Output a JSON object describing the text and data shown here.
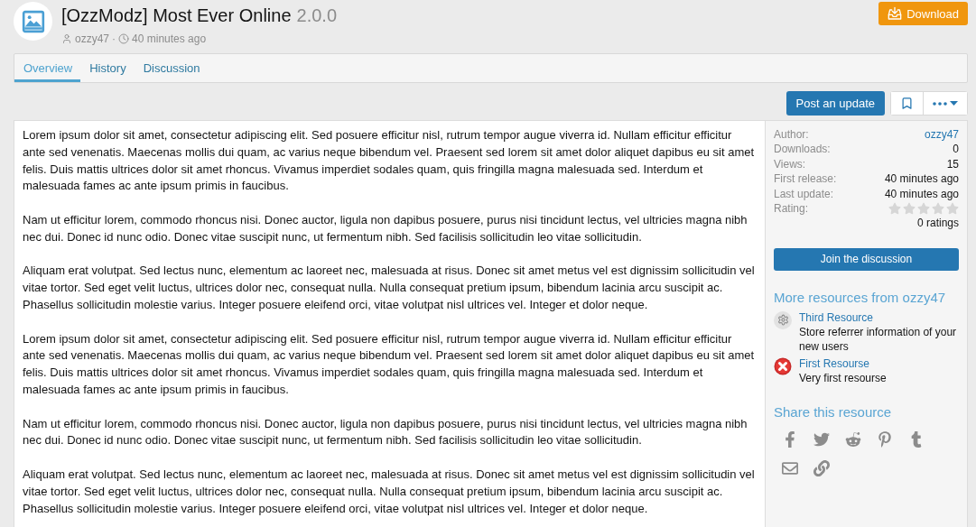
{
  "header": {
    "title": "[OzzModz] Most Ever Online",
    "version": "2.0.0",
    "author": "ozzy47",
    "separator": "·",
    "time": "40 minutes ago",
    "download_button": "Download"
  },
  "tabs": [
    {
      "label": "Overview",
      "selected": true
    },
    {
      "label": "History",
      "selected": false
    },
    {
      "label": "Discussion",
      "selected": false
    }
  ],
  "actions": {
    "post_button": "Post an update"
  },
  "description": {
    "paragraphs": [
      "Lorem ipsum dolor sit amet, consectetur adipiscing elit. Sed posuere efficitur nisl, rutrum tempor augue viverra id. Nullam efficitur efficitur ante sed venenatis. Maecenas mollis dui quam, ac varius neque bibendum vel. Praesent sed lorem sit amet dolor aliquet dapibus eu sit amet felis. Duis mattis ultrices dolor sit amet rhoncus. Vivamus imperdiet sodales quam, quis fringilla magna malesuada sed. Interdum et malesuada fames ac ante ipsum primis in faucibus.",
      "Nam ut efficitur lorem, commodo rhoncus nisi. Donec auctor, ligula non dapibus posuere, purus nisi tincidunt lectus, vel ultricies magna nibh nec dui. Donec id nunc odio. Donec vitae suscipit nunc, ut fermentum nibh. Sed facilisis sollicitudin leo vitae sollicitudin.",
      "Aliquam erat volutpat. Sed lectus nunc, elementum ac laoreet nec, malesuada at risus. Donec sit amet metus vel est dignissim sollicitudin vel vitae tortor. Sed eget velit luctus, ultrices dolor nec, consequat nulla. Nulla consequat pretium ipsum, bibendum lacinia arcu suscipit ac. Phasellus sollicitudin molestie varius. Integer posuere eleifend orci, vitae volutpat nisl ultrices vel. Integer et dolor neque.",
      "Lorem ipsum dolor sit amet, consectetur adipiscing elit. Sed posuere efficitur nisl, rutrum tempor augue viverra id. Nullam efficitur efficitur ante sed venenatis. Maecenas mollis dui quam, ac varius neque bibendum vel. Praesent sed lorem sit amet dolor aliquet dapibus eu sit amet felis. Duis mattis ultrices dolor sit amet rhoncus. Vivamus imperdiet sodales quam, quis fringilla magna malesuada sed. Interdum et malesuada fames ac ante ipsum primis in faucibus.",
      "Nam ut efficitur lorem, commodo rhoncus nisi. Donec auctor, ligula non dapibus posuere, purus nisi tincidunt lectus, vel ultricies magna nibh nec dui. Donec id nunc odio. Donec vitae suscipit nunc, ut fermentum nibh. Sed facilisis sollicitudin leo vitae sollicitudin.",
      "Aliquam erat volutpat. Sed lectus nunc, elementum ac laoreet nec, malesuada at risus. Donec sit amet metus vel est dignissim sollicitudin vel vitae tortor. Sed eget velit luctus, ultrices dolor nec, consequat nulla. Nulla consequat pretium ipsum, bibendum lacinia arcu suscipit ac. Phasellus sollicitudin molestie varius. Integer posuere eleifend orci, vitae volutpat nisl ultrices vel. Integer et dolor neque."
    ]
  },
  "sidebar": {
    "info": [
      {
        "kind": "link",
        "label": "Author:",
        "value": "ozzy47"
      },
      {
        "kind": "text",
        "label": "Downloads:",
        "value": "0"
      },
      {
        "kind": "text",
        "label": "Views:",
        "value": "15"
      },
      {
        "kind": "text",
        "label": "First release:",
        "value": "40 minutes ago"
      },
      {
        "kind": "text",
        "label": "Last update:",
        "value": "40 minutes ago"
      },
      {
        "kind": "rating",
        "label": "Rating:",
        "stars": 0,
        "count": "0 ratings"
      }
    ],
    "join_button": "Join the discussion",
    "more_heading": "More resources from ozzy47",
    "resources": [
      {
        "kind": "settings",
        "title": "Third Resource",
        "description": "Store referrer information of your new users"
      },
      {
        "kind": "error",
        "title": "First Resourse",
        "description": "Very first resourse"
      }
    ],
    "share_heading": "Share this resource"
  }
}
